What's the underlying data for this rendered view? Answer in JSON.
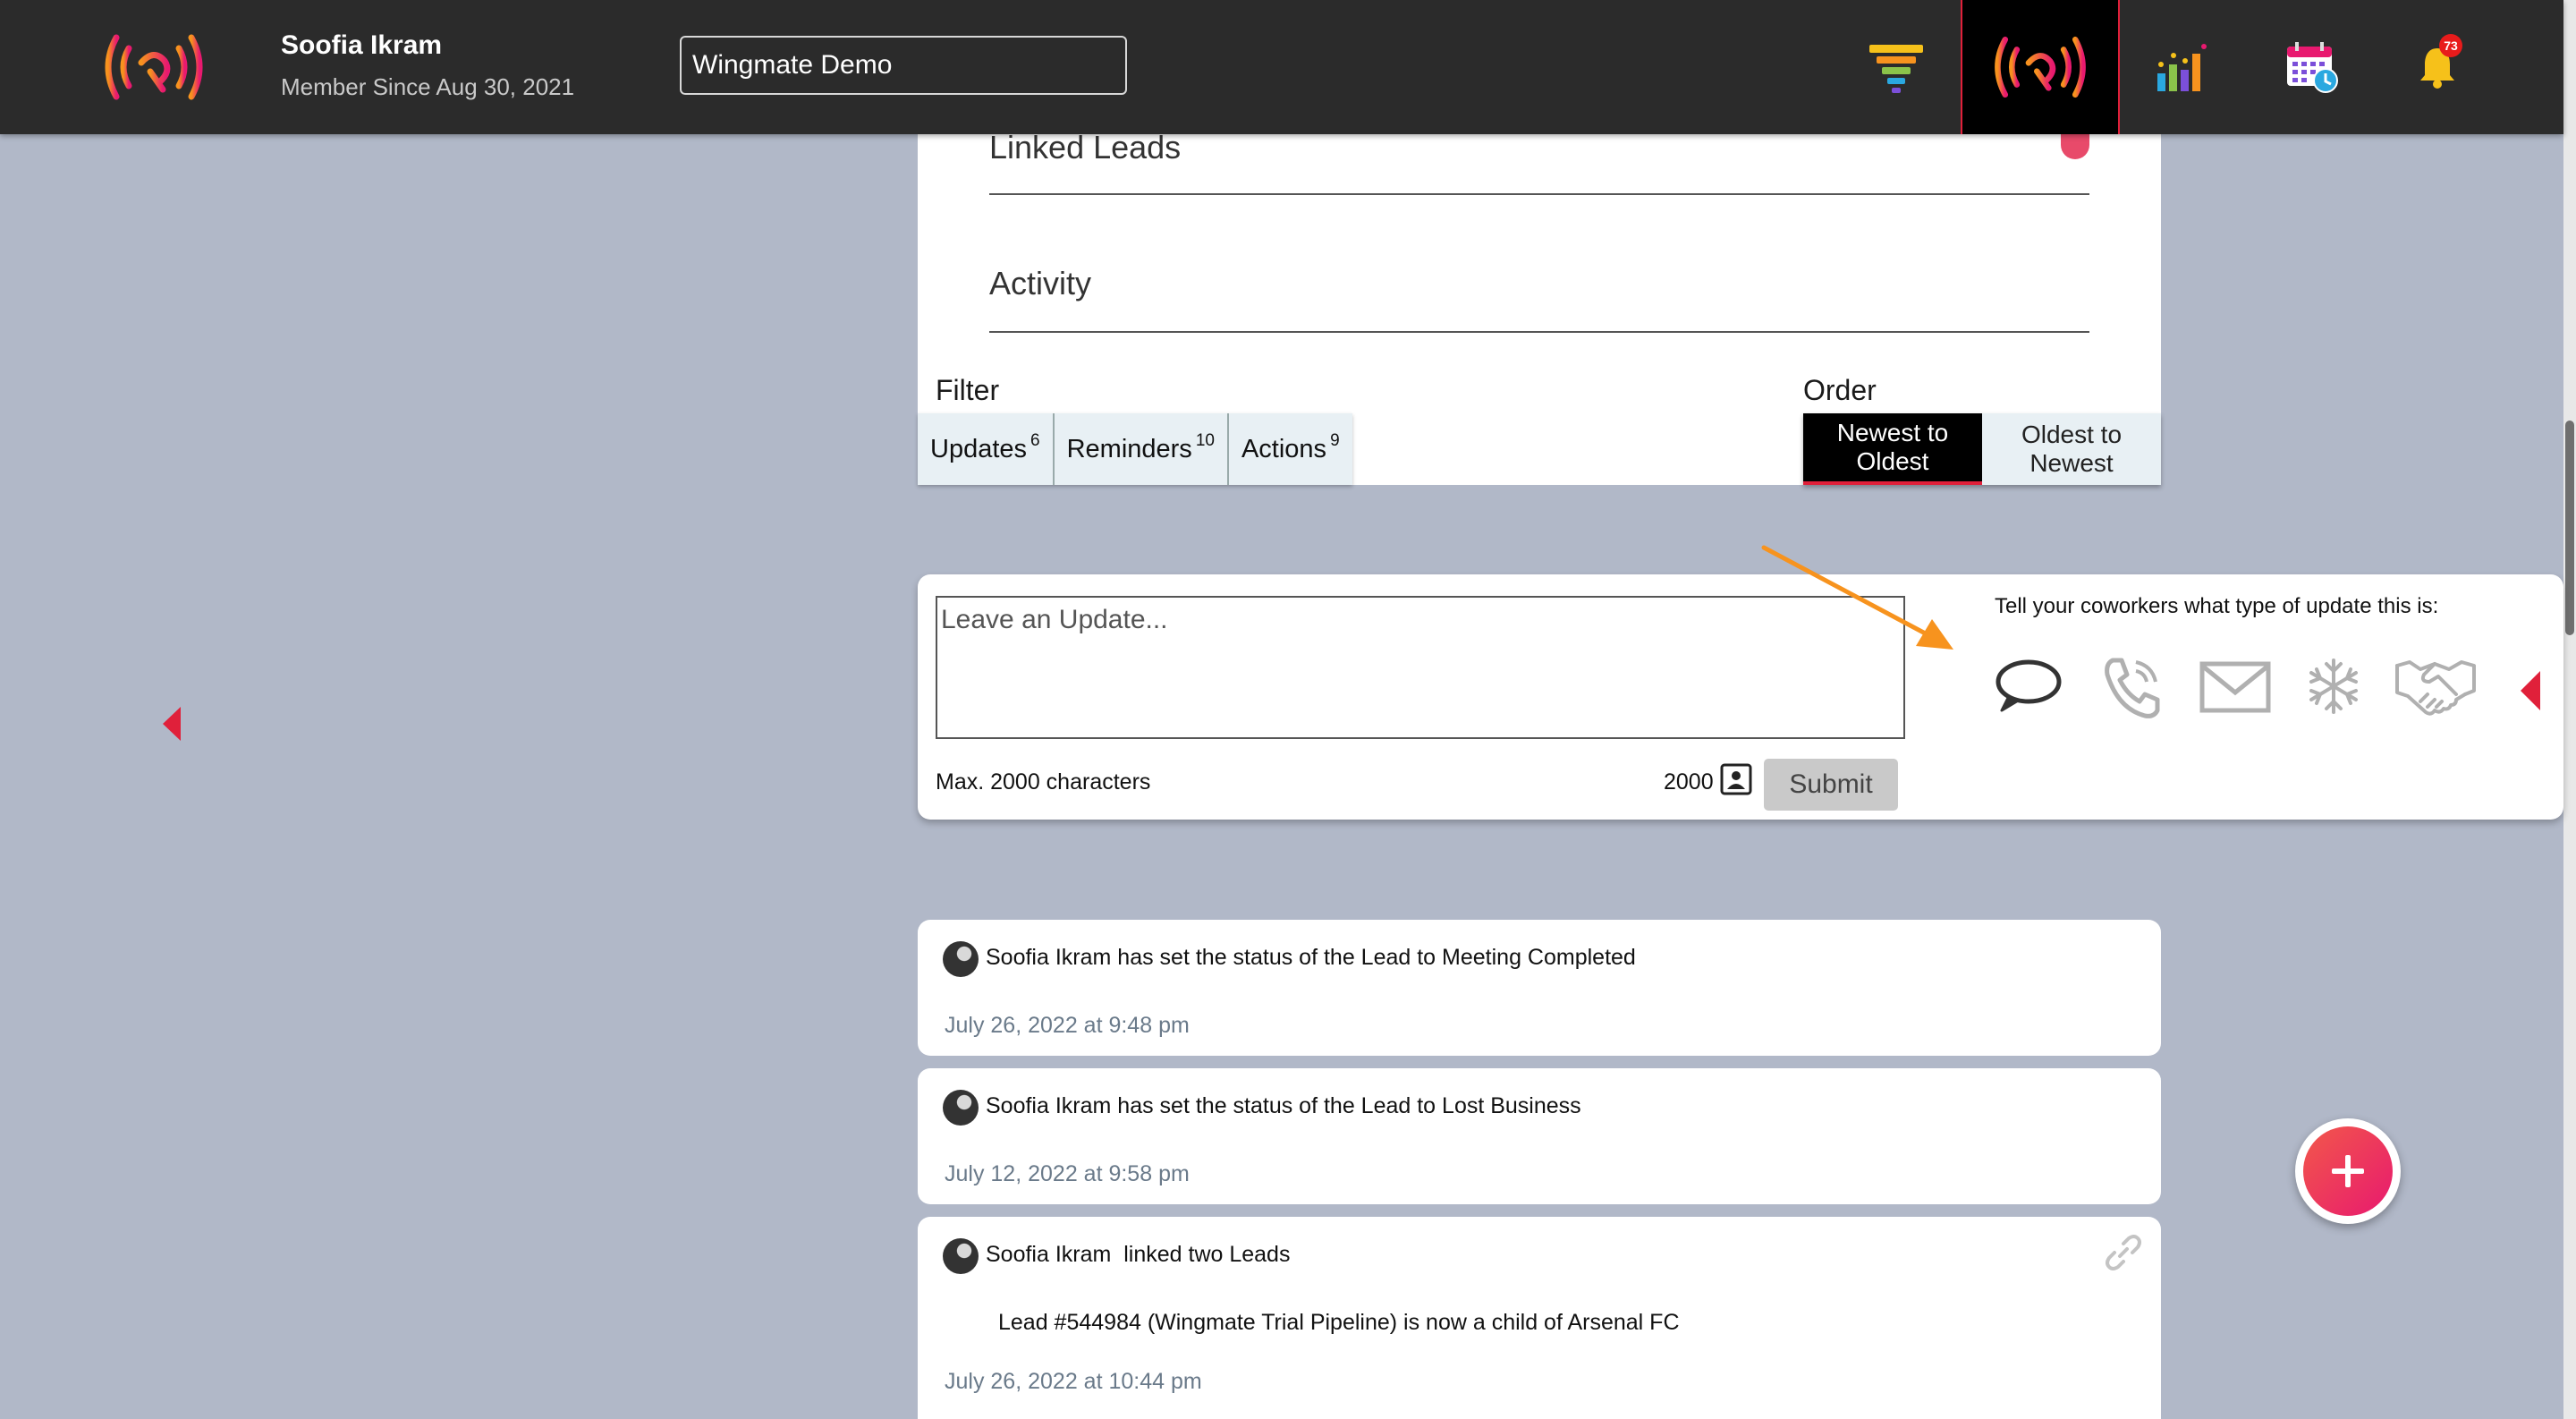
{
  "header": {
    "user_name": "Soofia Ikram",
    "member_since": "Member Since Aug 30, 2021",
    "workspace_value": "Wingmate Demo",
    "notifications_count": "73",
    "nav_icons": [
      "funnel-icon",
      "signal-icon",
      "bar-chart-icon",
      "calendar-icon",
      "bell-icon"
    ]
  },
  "sections": {
    "linked_leads": "Linked Leads",
    "activity": "Activity"
  },
  "filter": {
    "label": "Filter",
    "buttons": [
      {
        "label": "Updates",
        "count": "6"
      },
      {
        "label": "Reminders",
        "count": "10"
      },
      {
        "label": "Actions",
        "count": "9"
      }
    ]
  },
  "order": {
    "label": "Order",
    "options": [
      "Newest to\nOldest",
      "Oldest to\nNewest"
    ],
    "selected": "Newest to\nOldest"
  },
  "update": {
    "placeholder": "Leave an Update...",
    "max_label": "Max. 2000 characters",
    "char_count": "2000",
    "submit_label": "Submit",
    "type_prompt": "Tell your coworkers what type of update this is:",
    "type_icons": [
      "comment-icon",
      "phone-icon",
      "email-icon",
      "snowflake-icon",
      "handshake-icon"
    ]
  },
  "activities": [
    {
      "actor": "Soofia Ikram",
      "text": " has set the status of the Lead to Meeting Completed",
      "time": "July 26, 2022 at 9:48 pm"
    },
    {
      "actor": "Soofia Ikram",
      "text": " has set the status of the Lead to Lost Business",
      "time": "July 12, 2022 at 9:58 pm"
    },
    {
      "actor": "Soofia Ikram",
      "text": "  linked two Leads",
      "detail": "Lead #544984 (Wingmate Trial Pipeline) is now a child of Arsenal FC",
      "time": "July 26, 2022 at 10:44 pm"
    }
  ],
  "colors": {
    "accent_red": "#e0203a",
    "accent_orange": "#f7931e",
    "background": "#b1b8c8",
    "topbar": "#2b2b2b"
  }
}
